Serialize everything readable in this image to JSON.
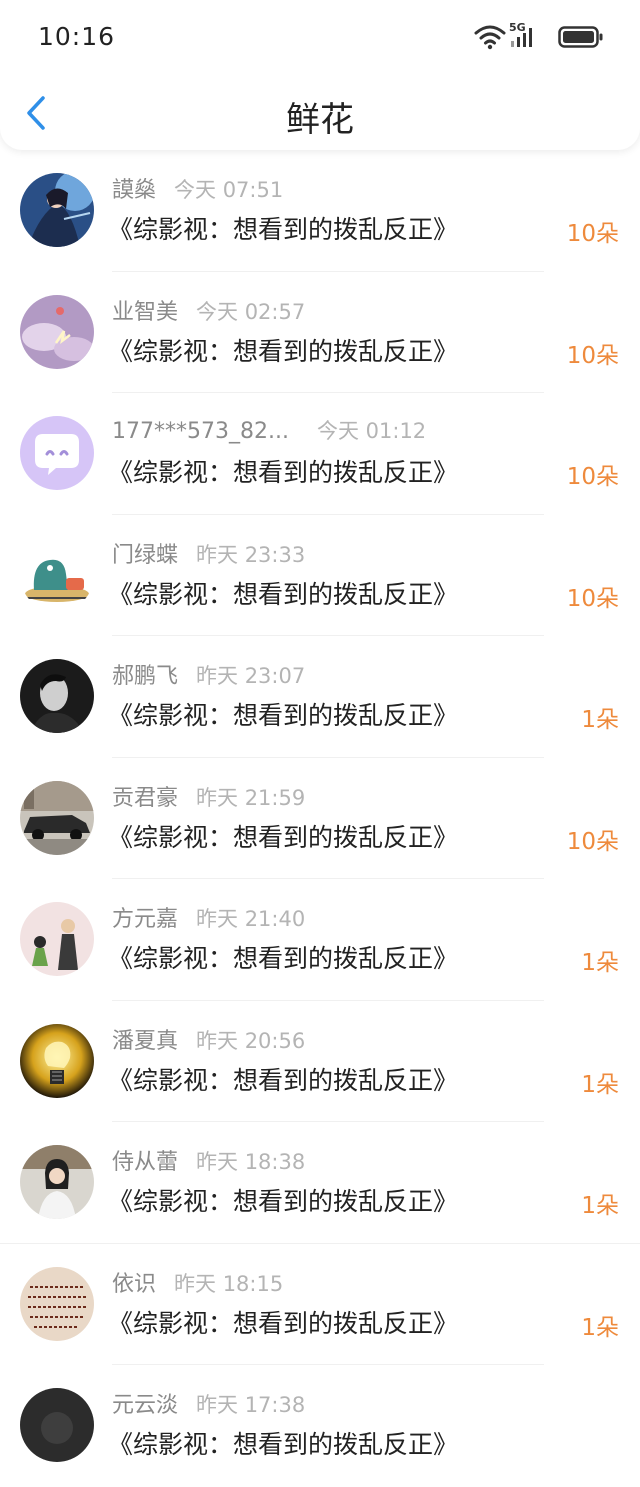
{
  "status_bar": {
    "time": "10:16",
    "network": "5G",
    "icons": [
      "wifi-icon",
      "signal-icon",
      "battery-icon"
    ]
  },
  "nav": {
    "back_icon": "chevron-left-icon",
    "title": "鲜花"
  },
  "colors": {
    "accent": "#2f8fe8",
    "flower_count": "#ee8a3c",
    "name": "#8a8a8a",
    "time": "#b4b4b4"
  },
  "items": [
    {
      "name": "謨燊",
      "time": "今天 07:51",
      "title": "《综影视：想看到的拨乱反正》",
      "count": "10朵",
      "avatar": "anime-character-avatar"
    },
    {
      "name": "业智美",
      "time": "今天 02:57",
      "title": "《综影视：想看到的拨乱反正》",
      "count": "10朵",
      "avatar": "purple-sky-avatar"
    },
    {
      "name": "177***573_82...",
      "time": "今天 01:12",
      "title": "《综影视：想看到的拨乱反正》",
      "count": "10朵",
      "avatar": "chat-bubble-avatar"
    },
    {
      "name": "门绿蝶",
      "time": "昨天 23:33",
      "title": "《综影视：想看到的拨乱反正》",
      "count": "10朵",
      "avatar": "cartoon-avatar"
    },
    {
      "name": "郝鹏飞",
      "time": "昨天 23:07",
      "title": "《综影视：想看到的拨乱反正》",
      "count": "1朵",
      "avatar": "portrait-bw-avatar"
    },
    {
      "name": "贡君豪",
      "time": "昨天 21:59",
      "title": "《综影视：想看到的拨乱反正》",
      "count": "10朵",
      "avatar": "car-avatar"
    },
    {
      "name": "方元嘉",
      "time": "昨天 21:40",
      "title": "《综影视：想看到的拨乱反正》",
      "count": "1朵",
      "avatar": "illustration-avatar"
    },
    {
      "name": "潘夏真",
      "time": "昨天 20:56",
      "title": "《综影视：想看到的拨乱反正》",
      "count": "1朵",
      "avatar": "lightbulb-avatar"
    },
    {
      "name": "侍从蕾",
      "time": "昨天 18:38",
      "title": "《综影视：想看到的拨乱反正》",
      "count": "1朵",
      "avatar": "girl-photo-avatar"
    },
    {
      "name": "依识",
      "time": "昨天 18:15",
      "title": "《综影视：想看到的拨乱反正》",
      "count": "1朵",
      "avatar": "handwriting-avatar"
    },
    {
      "name": "元云淡",
      "time": "昨天 17:38",
      "title": "《综影视：想看到的拨乱反正》",
      "count": "",
      "avatar": "dark-photo-avatar"
    }
  ]
}
